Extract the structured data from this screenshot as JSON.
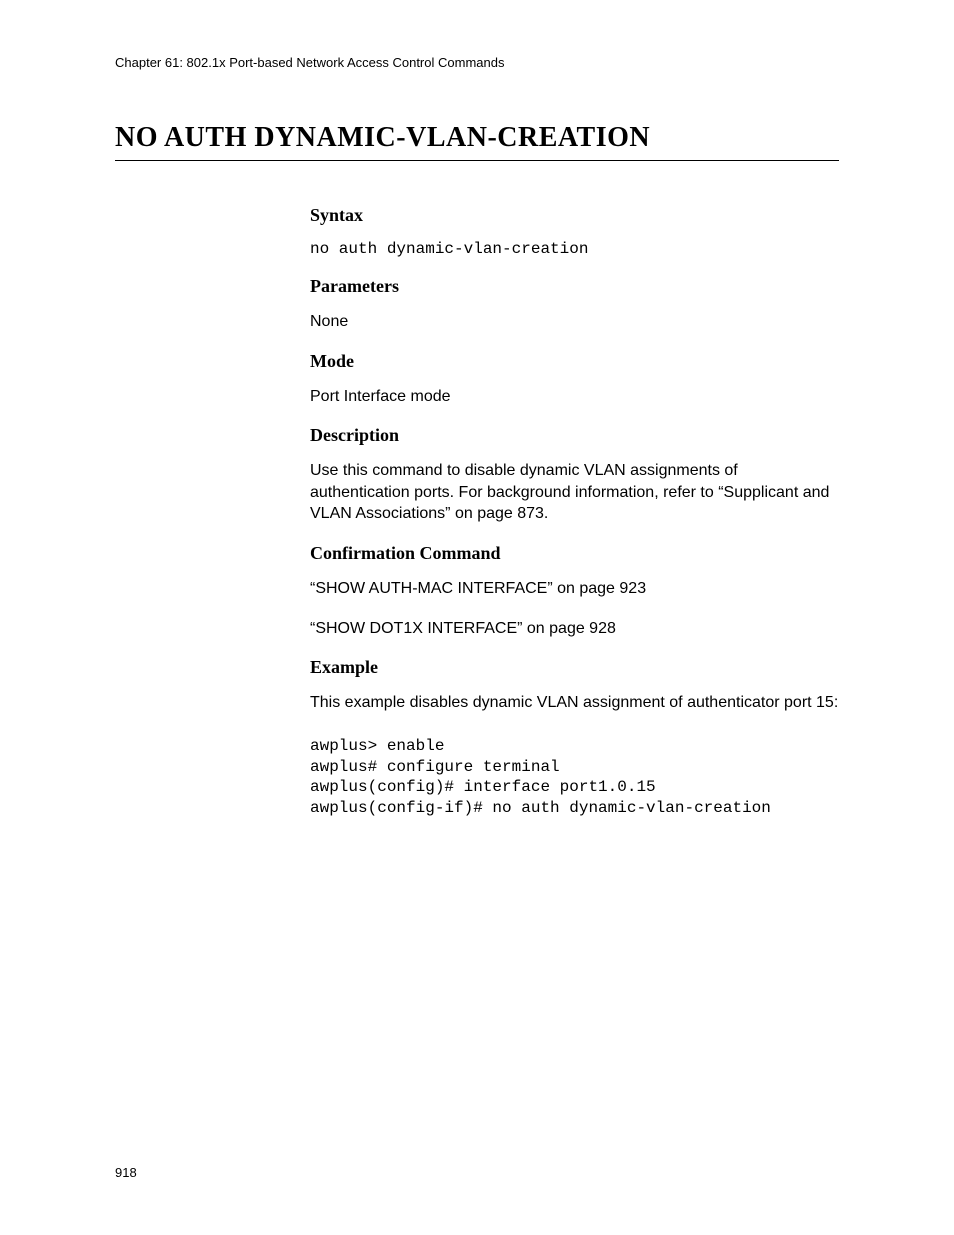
{
  "header": {
    "chapter": "Chapter 61: 802.1x Port-based Network Access Control Commands"
  },
  "title": "NO AUTH DYNAMIC-VLAN-CREATION",
  "sections": {
    "syntax": {
      "heading": "Syntax",
      "code": "no auth dynamic-vlan-creation"
    },
    "parameters": {
      "heading": "Parameters",
      "text": "None"
    },
    "mode": {
      "heading": "Mode",
      "text": "Port Interface mode"
    },
    "description": {
      "heading": "Description",
      "text": "Use this command to disable dynamic VLAN assignments of authentication ports. For background information, refer to “Supplicant and VLAN Associations” on page 873."
    },
    "confirmation": {
      "heading": "Confirmation Command",
      "line1": "“SHOW AUTH-MAC INTERFACE” on page 923",
      "line2": "“SHOW DOT1X INTERFACE” on page 928"
    },
    "example": {
      "heading": "Example",
      "intro": "This example disables dynamic VLAN assignment of authenticator port 15:",
      "code": "awplus> enable\nawplus# configure terminal\nawplus(config)# interface port1.0.15\nawplus(config-if)# no auth dynamic-vlan-creation"
    }
  },
  "pageNumber": "918"
}
